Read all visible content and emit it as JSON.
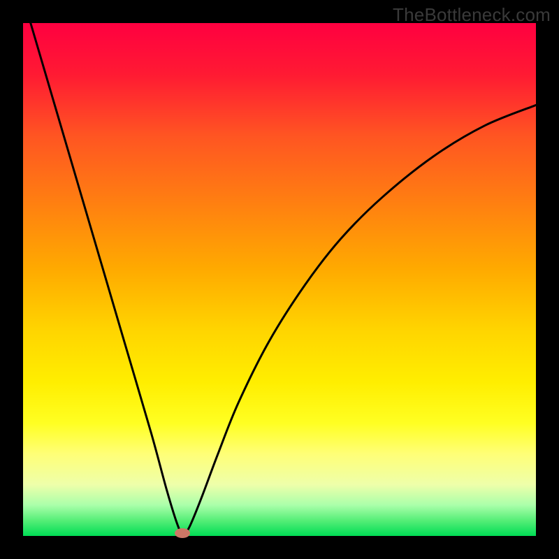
{
  "watermark": "TheBottleneck.com",
  "chart_data": {
    "type": "line",
    "title": "",
    "xlabel": "",
    "ylabel": "",
    "xlim": [
      0,
      100
    ],
    "ylim": [
      0,
      100
    ],
    "series": [
      {
        "name": "bottleneck-curve",
        "x": [
          0,
          5,
          10,
          15,
          20,
          25,
          28,
          30,
          31,
          32,
          33,
          35,
          38,
          42,
          48,
          55,
          62,
          70,
          80,
          90,
          100
        ],
        "values": [
          105,
          88,
          71,
          54,
          37,
          20,
          9,
          2.5,
          0.5,
          1,
          3,
          8,
          16,
          26,
          38,
          49,
          58,
          66,
          74,
          80,
          84
        ]
      }
    ],
    "marker": {
      "x": 31,
      "y": 0.5,
      "color": "#cc7766"
    },
    "gradient_stops": [
      {
        "pos": 0,
        "color": "#ff0040"
      },
      {
        "pos": 50,
        "color": "#ffd000"
      },
      {
        "pos": 85,
        "color": "#ffff88"
      },
      {
        "pos": 100,
        "color": "#00dd55"
      }
    ]
  }
}
